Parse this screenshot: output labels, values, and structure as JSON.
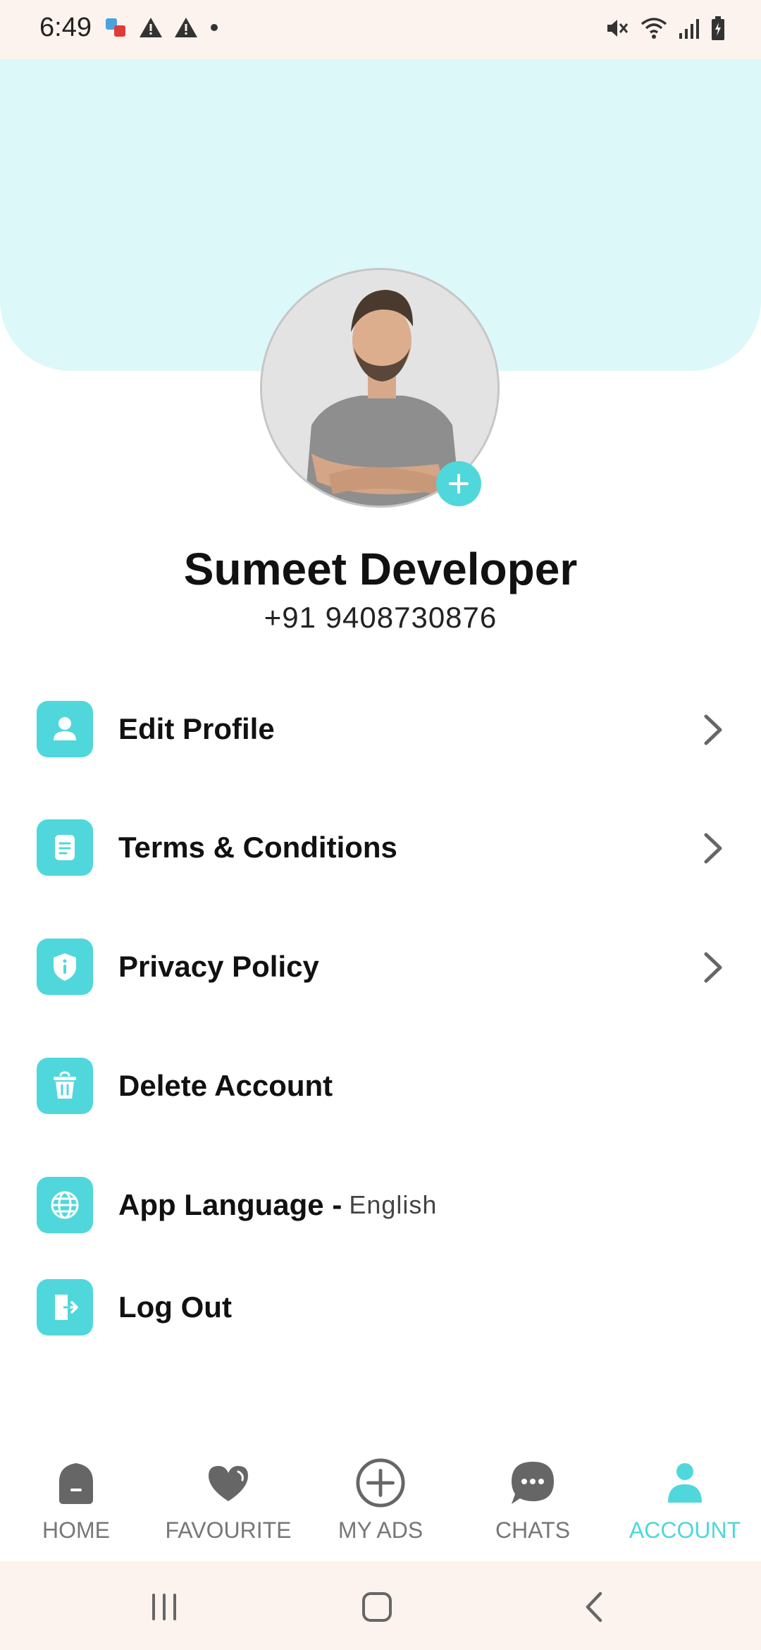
{
  "status": {
    "time": "6:49"
  },
  "profile": {
    "name": "Sumeet Developer",
    "phone": "+91 9408730876"
  },
  "menu": {
    "items": [
      {
        "label": "Edit Profile",
        "icon": "person-icon"
      },
      {
        "label": "Terms & Conditions",
        "icon": "document-icon"
      },
      {
        "label": "Privacy Policy",
        "icon": "shield-icon"
      },
      {
        "label": "Delete Account",
        "icon": "trash-icon"
      },
      {
        "label": "App Language -",
        "value": "English",
        "icon": "globe-icon"
      },
      {
        "label": "Log Out",
        "icon": "logout-icon"
      }
    ]
  },
  "bottom_nav": {
    "items": [
      {
        "label": "HOME",
        "icon": "home-icon"
      },
      {
        "label": "FAVOURITE",
        "icon": "heart-icon"
      },
      {
        "label": "MY ADS",
        "icon": "add-circle-icon"
      },
      {
        "label": "CHATS",
        "icon": "chat-icon"
      },
      {
        "label": "ACCOUNT",
        "icon": "account-icon",
        "active": true
      }
    ]
  },
  "colors": {
    "accent": "#50d7dc",
    "header_bg": "#ddf8f8",
    "status_bar_bg": "#fdf3ee"
  }
}
